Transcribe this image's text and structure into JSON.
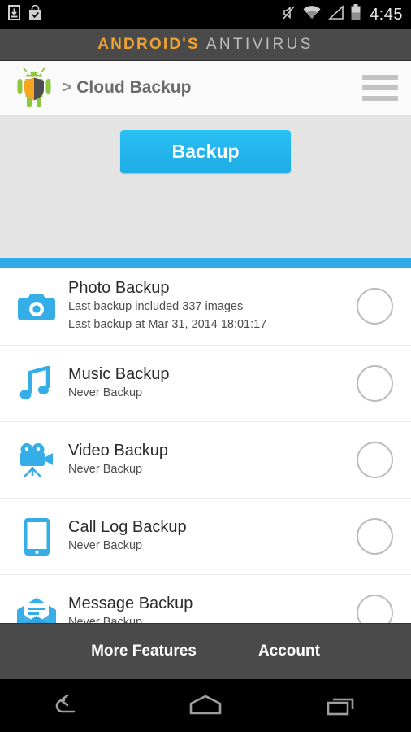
{
  "status_bar": {
    "time": "4:45",
    "icons": [
      "download-icon",
      "play-store-bag-icon",
      "mute-icon",
      "wifi-icon",
      "signal-icon",
      "battery-icon"
    ]
  },
  "brand_bar": {
    "primary": "ANDROID'S",
    "secondary": "ANTIVIRUS",
    "primary_color": "#f0a333",
    "secondary_color": "#bdbdbd",
    "background": "#4a4a4a"
  },
  "app_header": {
    "logo": "android-shield-logo",
    "separator": ">",
    "title": "Cloud Backup",
    "menu": "hamburger-menu-icon"
  },
  "panel": {
    "backup_button_label": "Backup",
    "background": "#e4e4e4",
    "accent": "#2eabe8"
  },
  "list": {
    "items": [
      {
        "icon": "camera-icon",
        "title": "Photo Backup",
        "sub1": "Last backup included 337 images",
        "sub2": "Last backup at Mar 31, 2014 18:01:17",
        "toggle": "off"
      },
      {
        "icon": "music-note-icon",
        "title": "Music Backup",
        "sub1": "Never Backup",
        "sub2": "",
        "toggle": "off"
      },
      {
        "icon": "video-camera-icon",
        "title": "Video Backup",
        "sub1": "Never Backup",
        "sub2": "",
        "toggle": "off"
      },
      {
        "icon": "phone-icon",
        "title": "Call Log Backup",
        "sub1": "Never Backup",
        "sub2": "",
        "toggle": "off"
      },
      {
        "icon": "envelope-message-icon",
        "title": "Message Backup",
        "sub1": "Never Backup",
        "sub2": "",
        "toggle": "off"
      }
    ]
  },
  "tab_bar": {
    "tabs": [
      {
        "label": "More Features"
      },
      {
        "label": "Account"
      }
    ]
  },
  "nav_bar": {
    "buttons": [
      "back-icon",
      "home-icon",
      "recents-icon"
    ]
  }
}
